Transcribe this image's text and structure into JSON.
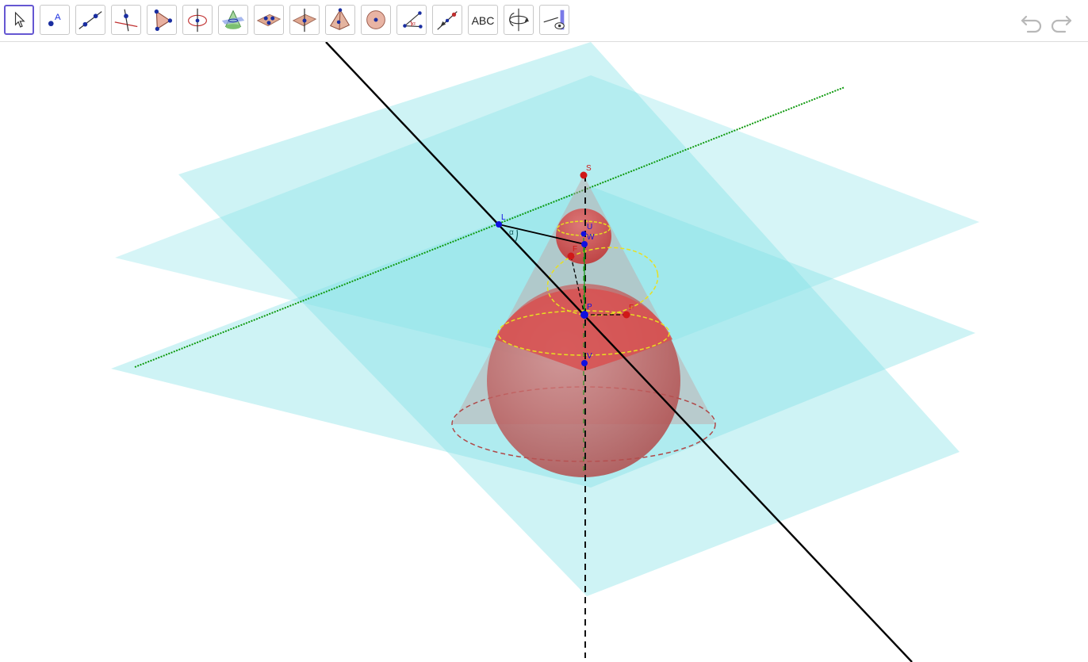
{
  "toolbar": {
    "tools": [
      {
        "id": "move",
        "icon": "cursor-arrow-icon",
        "selected": true
      },
      {
        "id": "point",
        "icon": "point-icon",
        "text": "A"
      },
      {
        "id": "line",
        "icon": "line-through-two-points-icon"
      },
      {
        "id": "perpendicular",
        "icon": "perpendicular-line-icon"
      },
      {
        "id": "polygon",
        "icon": "polygon-icon"
      },
      {
        "id": "circle-axis",
        "icon": "circle-around-axis-icon"
      },
      {
        "id": "intersect-surfaces",
        "icon": "intersect-surfaces-icon"
      },
      {
        "id": "plane-three-points",
        "icon": "plane-through-three-points-icon"
      },
      {
        "id": "perpendicular-plane",
        "icon": "perpendicular-plane-icon"
      },
      {
        "id": "pyramid",
        "icon": "pyramid-icon"
      },
      {
        "id": "sphere",
        "icon": "sphere-center-point-icon"
      },
      {
        "id": "angle",
        "icon": "angle-icon"
      },
      {
        "id": "reflect",
        "icon": "reflect-about-point-icon"
      },
      {
        "id": "text",
        "icon": "text-icon",
        "text": "ABC"
      },
      {
        "id": "rotate-view",
        "icon": "rotate-3d-view-icon"
      },
      {
        "id": "view-from",
        "icon": "view-in-front-of-icon"
      }
    ],
    "undo_icon": "undo-icon",
    "redo_icon": "redo-icon"
  },
  "scene": {
    "point_labels": {
      "S": "S",
      "L": "L",
      "U": "U",
      "W": "W",
      "F1": "F",
      "P": "P",
      "F2": "F",
      "V": "V",
      "angle": "α"
    },
    "colors": {
      "plane": "#7fe0e6",
      "axis_green": "#0f9a0f",
      "cone": "#b98c8c",
      "sphere": "#d65050",
      "ellipse": "#e8e020",
      "point_blue": "#1010e0",
      "point_red": "#d01818",
      "line": "#000000"
    }
  }
}
